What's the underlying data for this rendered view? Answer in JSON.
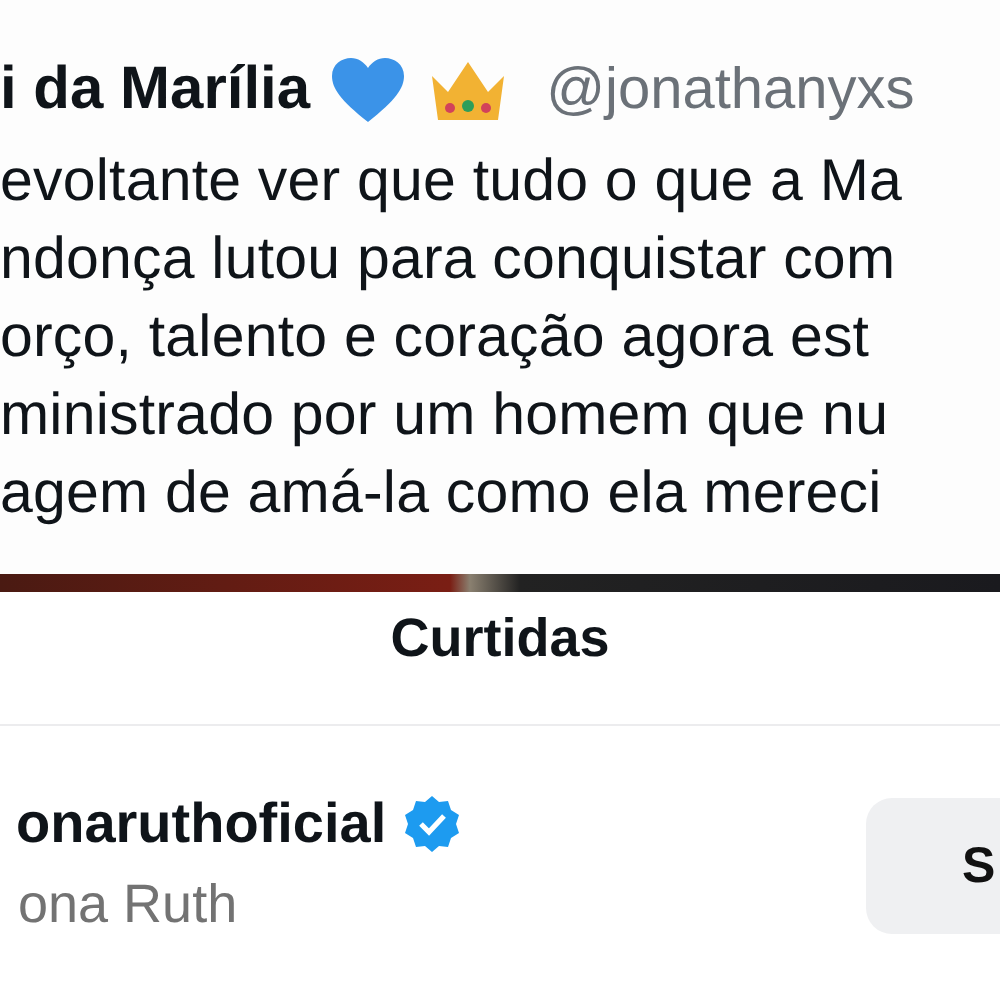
{
  "tweet": {
    "author_name": "i da Marília",
    "handle": "@jonathanyxs",
    "lines": [
      "evoltante ver que tudo o que a Ma",
      "ndonça lutou para conquistar com",
      "orço, talento e coração agora est",
      "ministrado por um homem que nu",
      "agem de amá-la como ela mereci"
    ]
  },
  "likes_sheet": {
    "title": "Curtidas",
    "users": [
      {
        "username": "onaruthoficial",
        "verified": true,
        "display_name": "ona Ruth",
        "button": "S"
      }
    ]
  }
}
